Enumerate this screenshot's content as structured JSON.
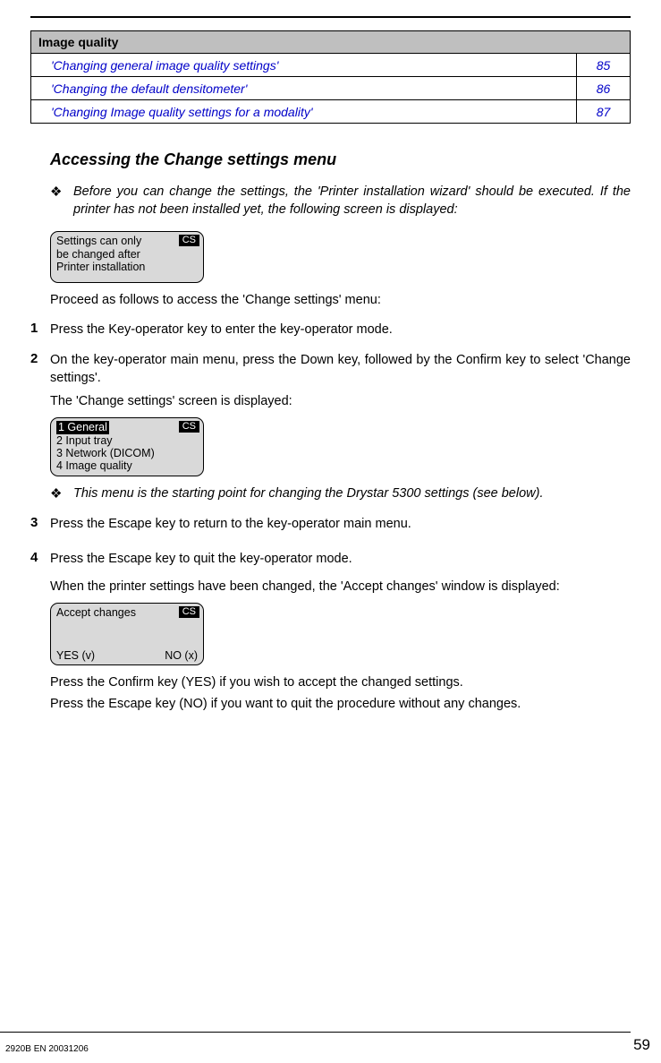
{
  "toc": {
    "header": "Image quality",
    "rows": [
      {
        "title": "'Changing general image quality settings'",
        "page": "85"
      },
      {
        "title": "'Changing the default densitometer'",
        "page": "86"
      },
      {
        "title": "'Changing Image quality settings for a modality'",
        "page": "87"
      }
    ]
  },
  "heading": "Accessing the Change settings menu",
  "note1": "Before you can change the settings, the 'Printer installation wizard' should be executed. If the printer has not been installed yet, the following screen is displayed:",
  "lcd1": {
    "badge": "CS",
    "line1": "Settings can only",
    "line2": "be changed after",
    "line3": "Printer installation"
  },
  "proceed": "Proceed as follows to access the 'Change settings' menu:",
  "steps": {
    "s1": "Press the Key-operator key to enter the key-operator mode.",
    "s2a": "On the key-operator main menu, press the Down key, followed by the Confirm key to select 'Change settings'.",
    "s2b": "The 'Change settings' screen is displayed:",
    "s3": "Press the Escape key to return to the key-operator main menu.",
    "s4a": "Press the Escape key to quit the key-operator mode.",
    "s4b": "When the printer settings have been changed, the 'Accept changes' window is displayed:"
  },
  "lcd2": {
    "badge": "CS",
    "line1": "1 General",
    "line2": "2 Input tray",
    "line3": "3 Network (DICOM)",
    "line4": "4 Image quality"
  },
  "note2": "This menu is the starting point for changing the Drystar 5300 settings (see below).",
  "lcd3": {
    "badge": "CS",
    "line1": "Accept changes",
    "yes": "YES (v)",
    "no": "NO (x)"
  },
  "post1": "Press the Confirm key (YES) if you wish to accept the changed settings.",
  "post2": "Press the Escape key (NO) if you want to quit the procedure without any changes.",
  "footer": {
    "doc": "2920B EN 20031206",
    "page": "59"
  },
  "nums": {
    "n1": "1",
    "n2": "2",
    "n3": "3",
    "n4": "4"
  },
  "bullet": "❖"
}
